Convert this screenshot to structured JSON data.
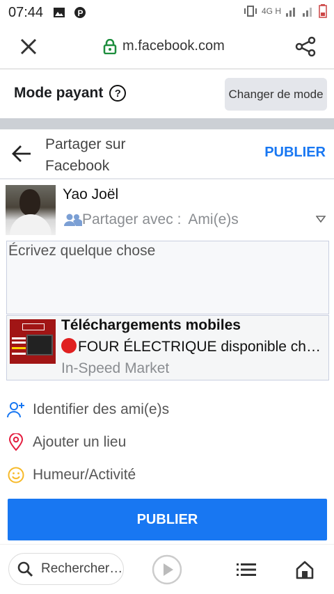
{
  "status_bar": {
    "time": "07:44",
    "network": "4G H"
  },
  "browser": {
    "url": "m.facebook.com"
  },
  "mode_bar": {
    "label": "Mode payant",
    "help": "?",
    "change_button": "Changer de mode"
  },
  "share_header": {
    "title": "Partager sur Facebook",
    "publish_link": "PUBLIER"
  },
  "user": {
    "name": "Yao Joël",
    "privacy_label": "Partager avec :",
    "privacy_value": "Ami(e)s"
  },
  "composer": {
    "placeholder": "Écrivez quelque chose"
  },
  "link_preview": {
    "title": "Téléchargements mobiles",
    "description": "FOUR ÉLECTRIQUE disponible chez In-Speed Market",
    "source": "In-Speed Market"
  },
  "options": [
    {
      "label": "Identifier des ami(e)s",
      "icon": "tag-friends-icon",
      "color": "#1877f2"
    },
    {
      "label": "Ajouter un lieu",
      "icon": "location-pin-icon",
      "color": "#e41e3f"
    },
    {
      "label": "Humeur/Activité",
      "icon": "smiley-icon",
      "color": "#f7b928"
    }
  ],
  "publish_button": "PUBLIER",
  "bottom_bar": {
    "search": "Rechercher…"
  },
  "colors": {
    "accent": "#1877f2",
    "graybar": "#ccd0d5"
  }
}
